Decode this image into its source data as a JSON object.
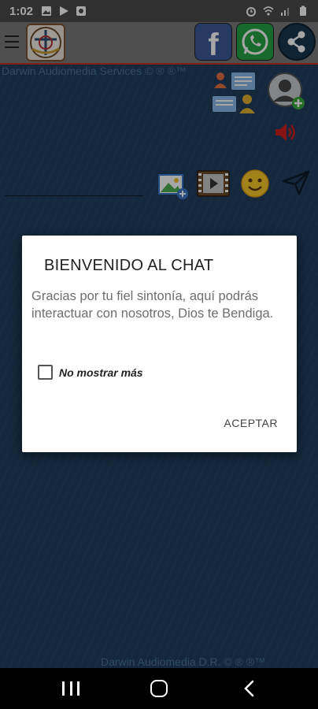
{
  "status_bar": {
    "time": "1:02",
    "left_icons": [
      "image-notification-icon",
      "play-store-icon",
      "app-notification-icon"
    ],
    "right_icons": [
      "alarm-icon",
      "wifi-icon",
      "signal-icon",
      "battery-icon"
    ]
  },
  "header": {
    "menu_icon": "hamburger-menu-icon",
    "logo_icon": "app-logo",
    "social_buttons": [
      {
        "name": "facebook",
        "glyph": "f",
        "color": "#3b5998"
      },
      {
        "name": "whatsapp",
        "color": "#25a244"
      },
      {
        "name": "share",
        "color": "#19364f"
      }
    ],
    "accent_color": "#c8321e"
  },
  "main": {
    "credits_top": "Darwin Audiomedia Services © ® ®™",
    "credits_bottom": "Darwin Audiomedia D.R. © ® ®™",
    "background_color": "#1f3d5c"
  },
  "dialog": {
    "title": "BIENVENIDO AL CHAT",
    "message": "Gracias por tu fiel sintonía, aquí podrás interactuar con nosotros, Dios te Bendiga.",
    "checkbox_label": "No mostrar más",
    "checkbox_checked": false,
    "accept_label": "ACEPTAR"
  },
  "nav_bar": {
    "icons": [
      "recents-icon",
      "home-icon",
      "back-icon"
    ]
  }
}
